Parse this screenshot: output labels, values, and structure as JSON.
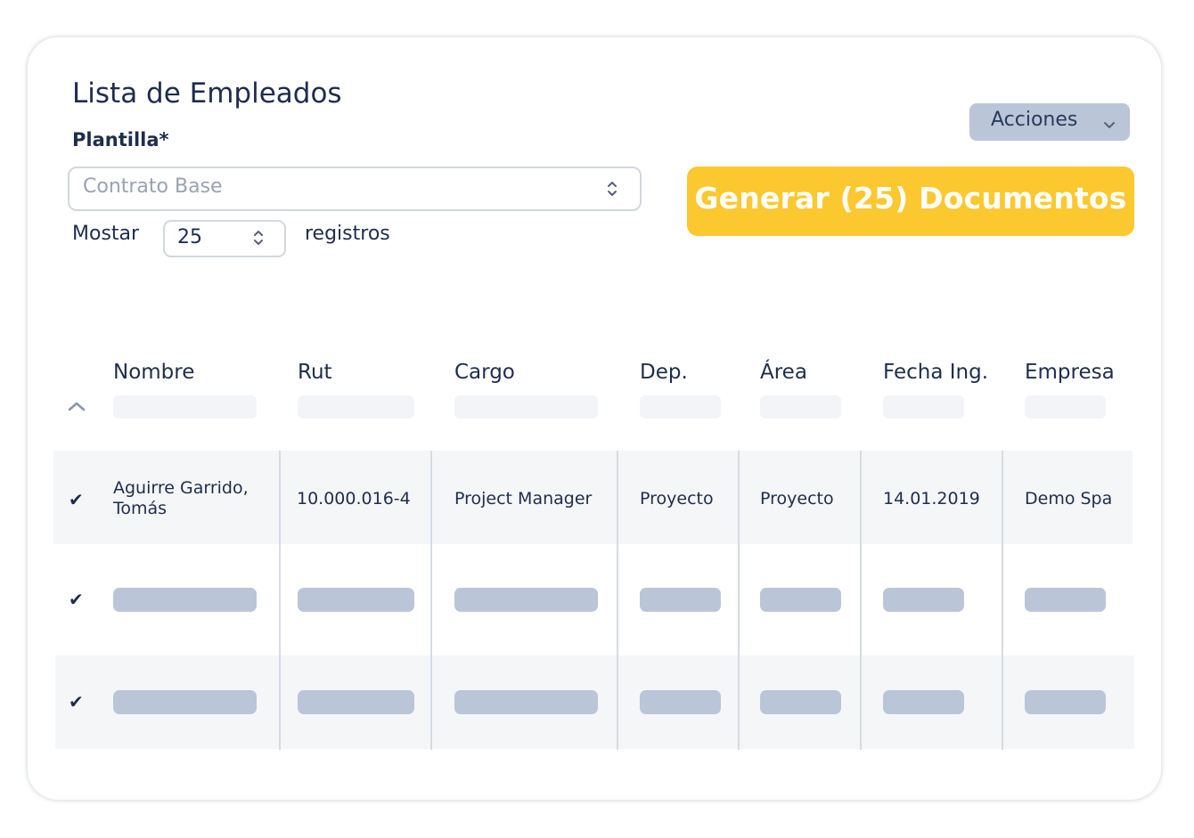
{
  "title": "Lista de Empleados",
  "plantilla": {
    "label": "Plantilla*",
    "value": "Contrato Base"
  },
  "pagination": {
    "prefix": "Mostar",
    "value": "25",
    "suffix": "registros"
  },
  "actions_button": "Acciones",
  "generate_button": "Generar (25) Documentos",
  "colors": {
    "accent": "#fcc82f",
    "text": "#1f2d4d",
    "placeholder_bar": "#bac5d8"
  },
  "table": {
    "headers": [
      "Nombre",
      "Rut",
      "Cargo",
      "Dep.",
      "Área",
      "Fecha Ing.",
      "Empresa"
    ],
    "rows": [
      {
        "checked": "✔",
        "nombre_line1": "Aguirre Garrido,",
        "nombre_line2": "Tomás",
        "rut": "10.000.016-4",
        "cargo": "Project Manager",
        "dep": "Proyecto",
        "area": "Proyecto",
        "fecha": "14.01.2019",
        "empresa": "Demo Spa"
      },
      {
        "checked": "✔"
      },
      {
        "checked": "✔"
      }
    ]
  }
}
